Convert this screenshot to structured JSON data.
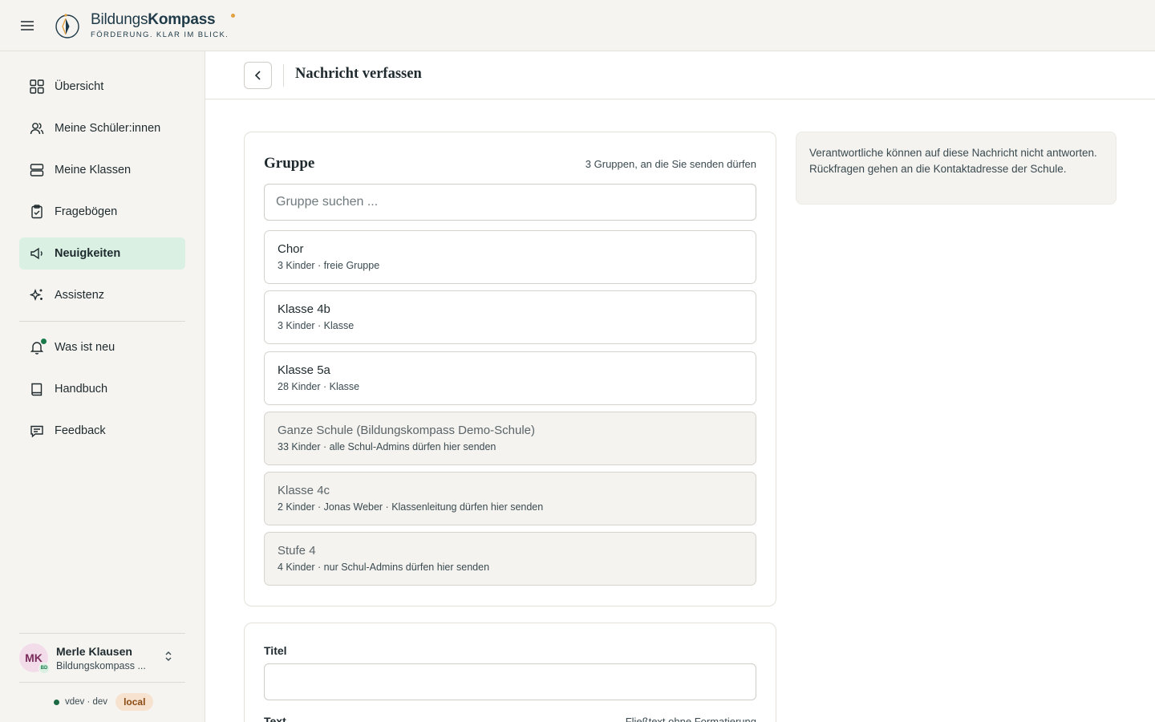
{
  "app": {
    "brand_light": "Bildungs",
    "brand_bold": "Kompass",
    "tagline": "FÖRDERUNG. KLAR IM BLICK.",
    "colors": {
      "accent": "#1b7a4a",
      "active_bg": "#d9f0e2",
      "brand": "#1f3a48",
      "brand_dot": "#e2a03f"
    }
  },
  "sidebar": {
    "items": [
      {
        "label": "Übersicht",
        "icon": "grid-icon"
      },
      {
        "label": "Meine Schüler:innen",
        "icon": "users-icon"
      },
      {
        "label": "Meine Klassen",
        "icon": "server-icon"
      },
      {
        "label": "Fragebögen",
        "icon": "clipboard-icon"
      },
      {
        "label": "Neuigkeiten",
        "icon": "megaphone-icon",
        "active": true
      },
      {
        "label": "Assistenz",
        "icon": "sparkles-icon"
      }
    ],
    "secondary": [
      {
        "label": "Was ist neu",
        "icon": "bell-icon",
        "has_notification": true
      },
      {
        "label": "Handbuch",
        "icon": "book-icon"
      },
      {
        "label": "Feedback",
        "icon": "message-icon"
      }
    ],
    "user": {
      "initials": "MK",
      "badge": "BD",
      "name": "Merle Klausen",
      "school": "Bildungskompass ..."
    },
    "env": {
      "text": "vdev · dev",
      "badge": "local"
    }
  },
  "header": {
    "title": "Nachricht verfassen"
  },
  "group_section": {
    "title": "Gruppe",
    "hint": "3 Gruppen, an die Sie senden dürfen",
    "search_placeholder": "Gruppe suchen ...",
    "groups": [
      {
        "name": "Chor",
        "meta": "3 Kinder · freie Gruppe",
        "enabled": true
      },
      {
        "name": "Klasse 4b",
        "meta": "3 Kinder · Klasse",
        "enabled": true
      },
      {
        "name": "Klasse 5a",
        "meta": "28 Kinder · Klasse",
        "enabled": true
      },
      {
        "name": "Ganze Schule (Bildungskompass Demo-Schule)",
        "meta": "33 Kinder · alle Schul-Admins dürfen hier senden",
        "enabled": false
      },
      {
        "name": "Klasse 4c",
        "meta": "2 Kinder · Jonas Weber · Klassenleitung dürfen hier senden",
        "enabled": false
      },
      {
        "name": "Stufe 4",
        "meta": "4 Kinder · nur Schul-Admins dürfen hier senden",
        "enabled": false
      }
    ]
  },
  "info": {
    "text": "Verantwortliche können auf diese Nachricht nicht antworten. Rückfragen gehen an die Kontaktadresse der Schule."
  },
  "compose": {
    "title_label": "Titel",
    "title_value": "",
    "text_label": "Text",
    "text_hint": "Fließtext ohne Formatierung"
  }
}
